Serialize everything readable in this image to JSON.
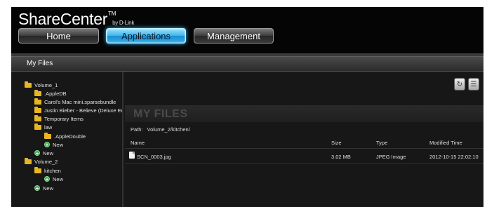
{
  "header": {
    "brand": "ShareCenter",
    "brand_tm": "TM",
    "brand_by": "by D-Link",
    "tabs": [
      {
        "label": "Home",
        "active": false
      },
      {
        "label": "Applications",
        "active": true
      },
      {
        "label": "Management",
        "active": false
      }
    ]
  },
  "panel": {
    "title": "My Files"
  },
  "tree": {
    "items": [
      {
        "label": "Volume_1",
        "icon": "folder-icon"
      },
      {
        "label": ".AppleDB",
        "icon": "folder-icon"
      },
      {
        "label": "Carol's Mac mini.sparsebundle",
        "icon": "folder-icon"
      },
      {
        "label": "Justin Bieber - Believe (Deluxe Ed",
        "icon": "folder-icon"
      },
      {
        "label": "Temporary Items",
        "icon": "folder-icon"
      },
      {
        "label": "law",
        "icon": "folder-icon"
      },
      {
        "label": ".AppleDouble",
        "icon": "folder-icon"
      },
      {
        "label": "New",
        "icon": "add-icon"
      },
      {
        "label": "New",
        "icon": "add-icon"
      },
      {
        "label": "Volume_2",
        "icon": "folder-icon"
      },
      {
        "label": "kitchen",
        "icon": "folder-icon"
      },
      {
        "label": "New",
        "icon": "add-icon"
      },
      {
        "label": "New",
        "icon": "add-icon"
      }
    ]
  },
  "main": {
    "title": "MY FILES",
    "path_label": "Path:",
    "path_value": "Volume_2/kitchen/",
    "columns": {
      "name": "Name",
      "size": "Size",
      "type": "Type",
      "modified": "Modified Time"
    },
    "files": [
      {
        "name": "SCN_0003.jpg",
        "size": "3.02 MB",
        "type": "JPEG Image",
        "modified": "2012-10-15 22:02:10"
      }
    ],
    "toolbar": [
      "refresh-icon",
      "properties-icon"
    ]
  },
  "colors": {
    "accent": "#3fb4ea",
    "folder": "#e9b623",
    "add": "#3aa34a"
  }
}
